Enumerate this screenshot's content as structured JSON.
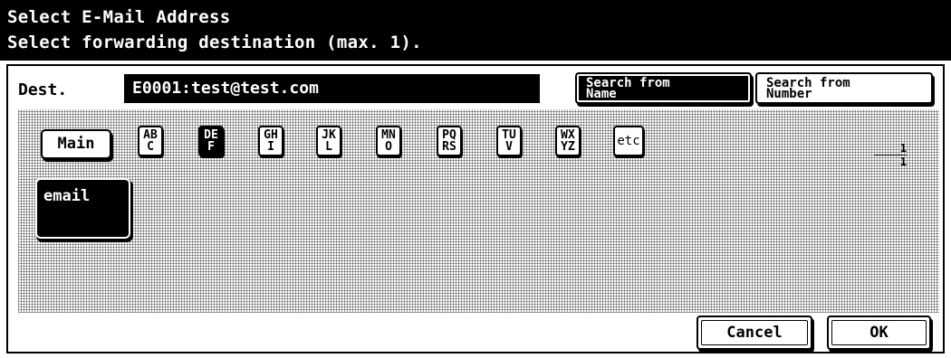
{
  "header": {
    "line1": "Select E-Mail Address",
    "line2": "Select forwarding destination (max. 1)."
  },
  "dest": {
    "label": "Dest.",
    "value": "E0001:test@test.com"
  },
  "search_tabs": [
    {
      "line1": "Search from",
      "line2": "Name",
      "selected": true
    },
    {
      "line1": "Search from",
      "line2": "Number",
      "selected": false
    }
  ],
  "index": {
    "main_label": "Main",
    "keys": [
      {
        "top": "AB",
        "bottom": "C",
        "active": false
      },
      {
        "top": "DE",
        "bottom": "F",
        "active": true
      },
      {
        "top": "GH",
        "bottom": "I",
        "active": false
      },
      {
        "top": "JK",
        "bottom": "L",
        "active": false
      },
      {
        "top": "MN",
        "bottom": "O",
        "active": false
      },
      {
        "top": "PQ",
        "bottom": "RS",
        "active": false
      },
      {
        "top": "TU",
        "bottom": "V",
        "active": false
      },
      {
        "top": "WX",
        "bottom": "YZ",
        "active": false
      }
    ],
    "etc_label": "etc"
  },
  "page": {
    "current": "1",
    "total": "1"
  },
  "entries": [
    {
      "label": "email",
      "selected": true
    }
  ],
  "footer": {
    "cancel_label": "Cancel",
    "ok_label": "OK"
  },
  "colors": {
    "header_bg": "#000000",
    "selected_bg": "#000000",
    "text_on_selected": "#ffffff"
  }
}
